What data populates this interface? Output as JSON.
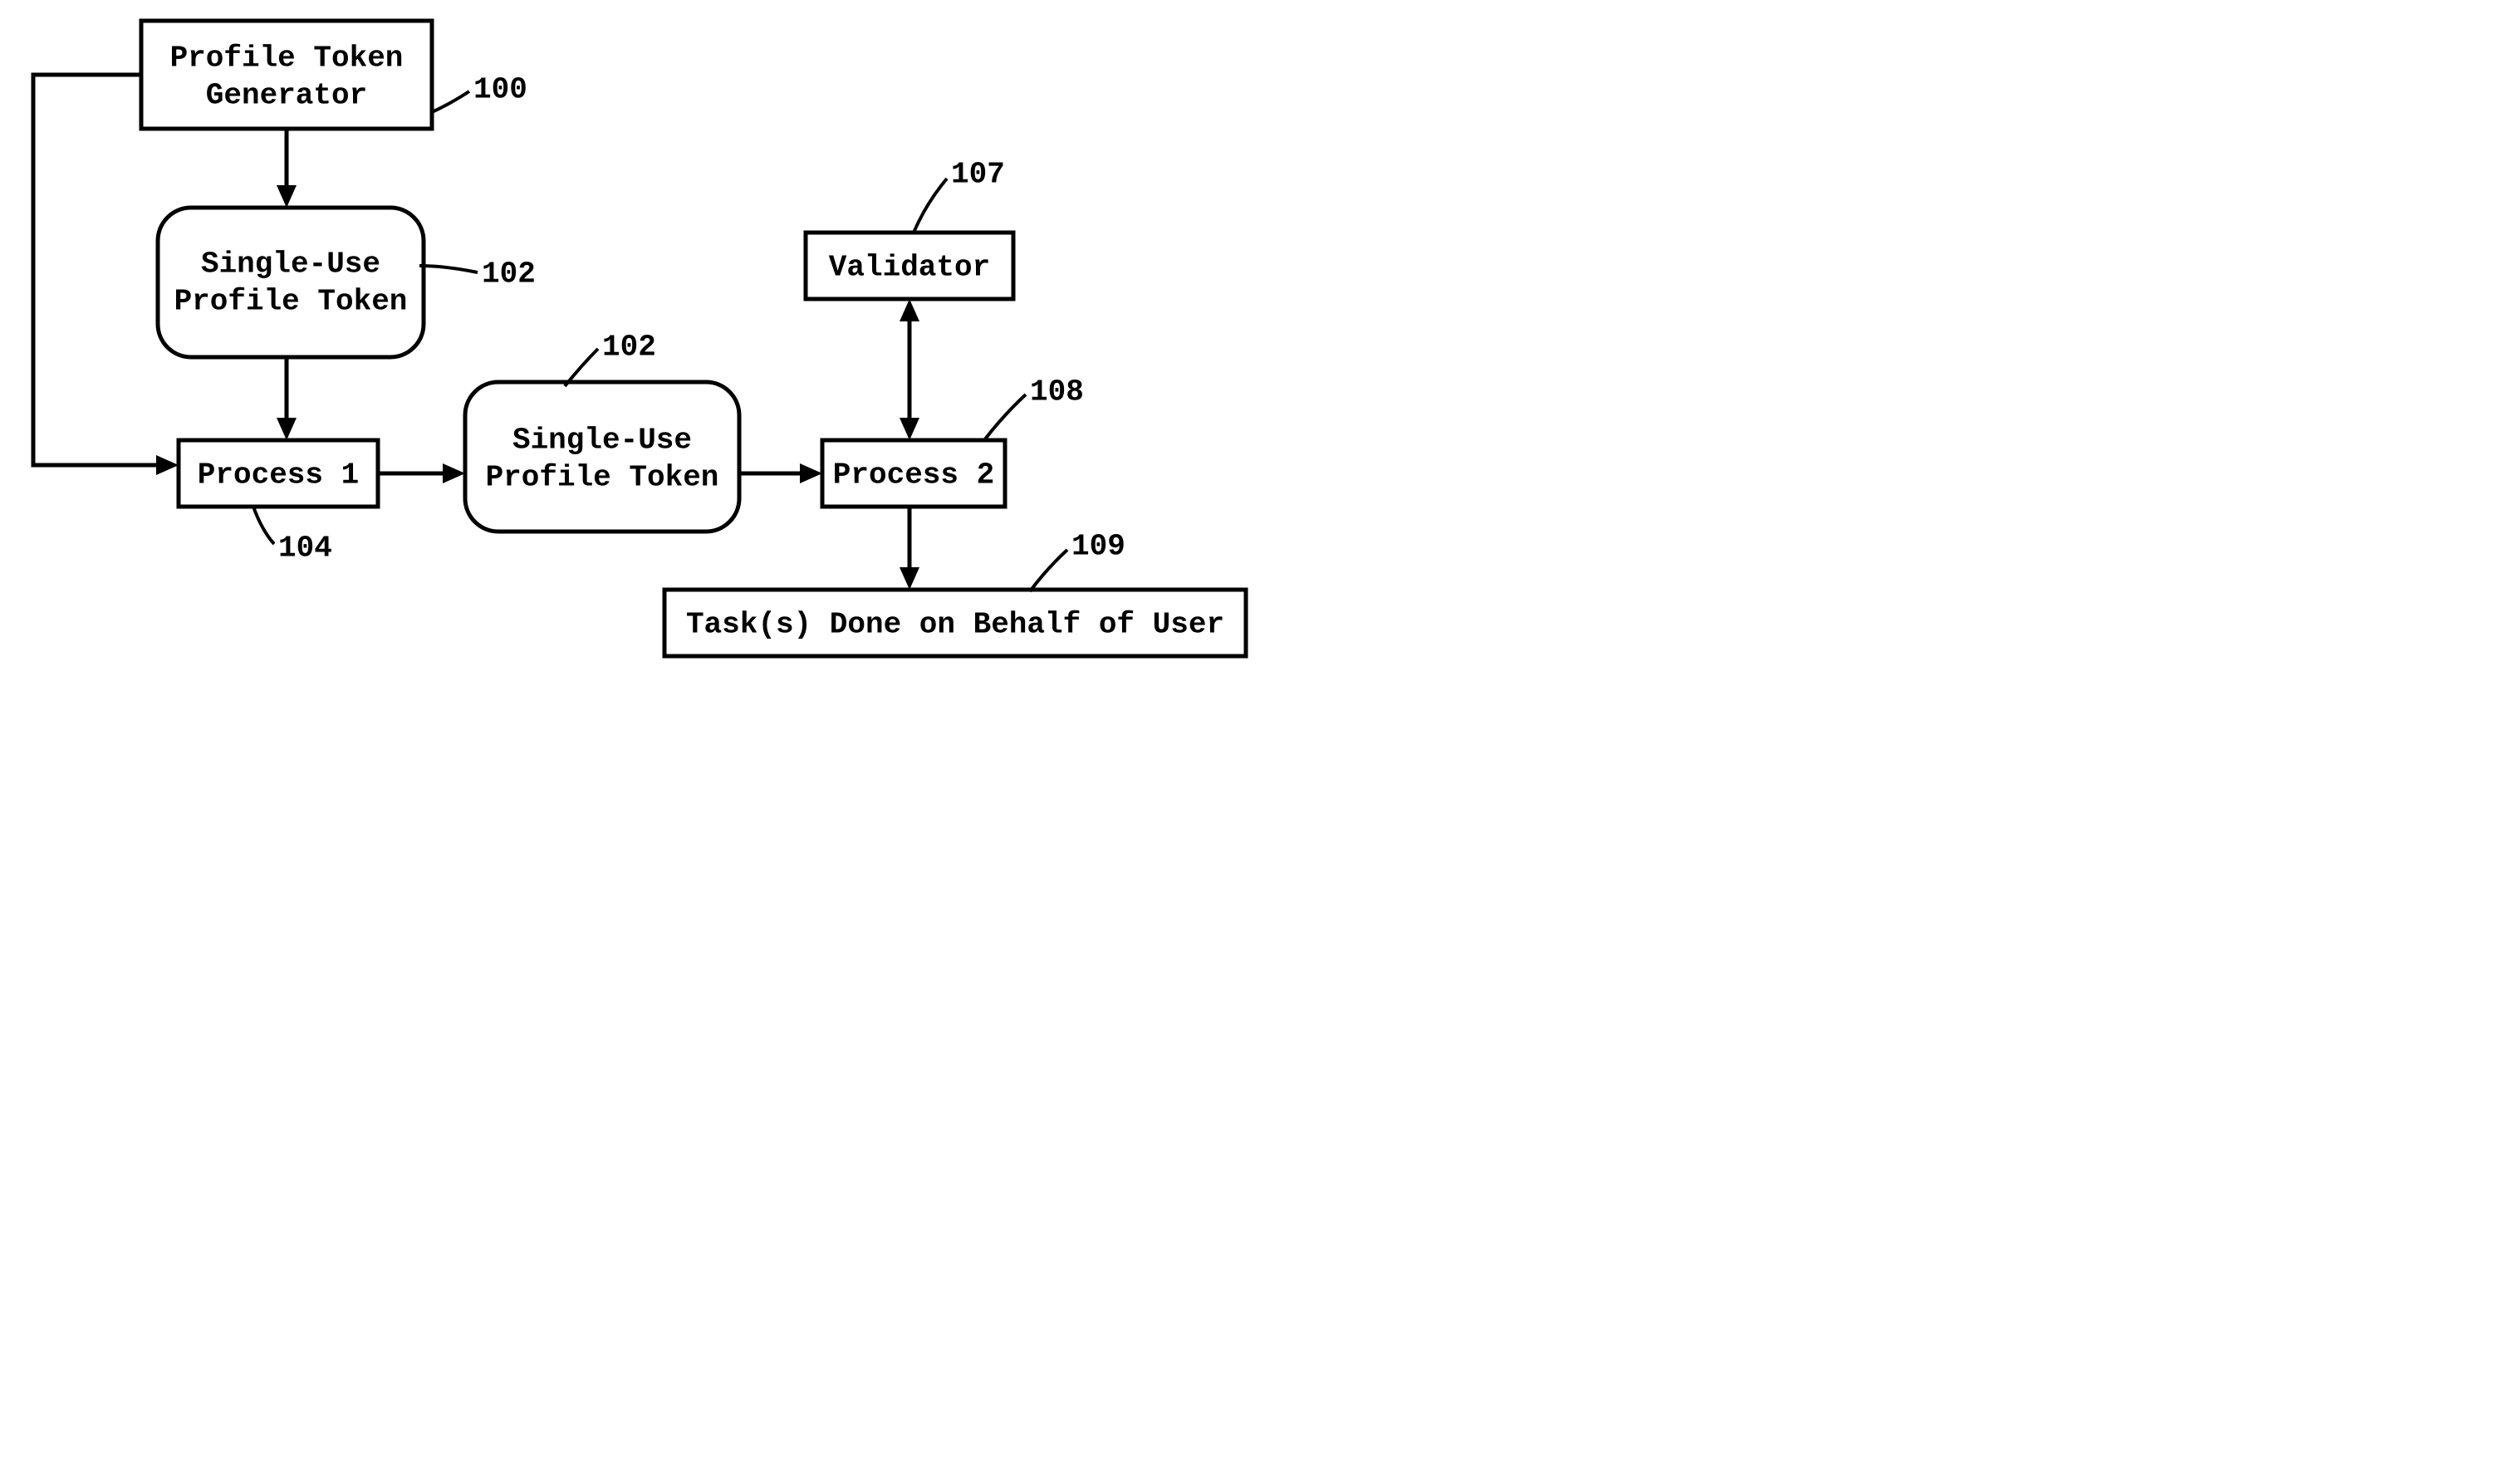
{
  "nodes": {
    "generator": {
      "line1": "Profile Token",
      "line2": "Generator",
      "ref": "100"
    },
    "token1": {
      "line1": "Single-Use",
      "line2": "Profile Token",
      "ref": "102"
    },
    "process1": {
      "line1": "Process 1",
      "ref": "104"
    },
    "token2": {
      "line1": "Single-Use",
      "line2": "Profile Token",
      "ref": "102"
    },
    "validator": {
      "line1": "Validator",
      "ref": "107"
    },
    "process2": {
      "line1": "Process 2",
      "ref": "108"
    },
    "tasks": {
      "line1": "Task(s) Done on Behalf of User",
      "ref": "109"
    }
  }
}
